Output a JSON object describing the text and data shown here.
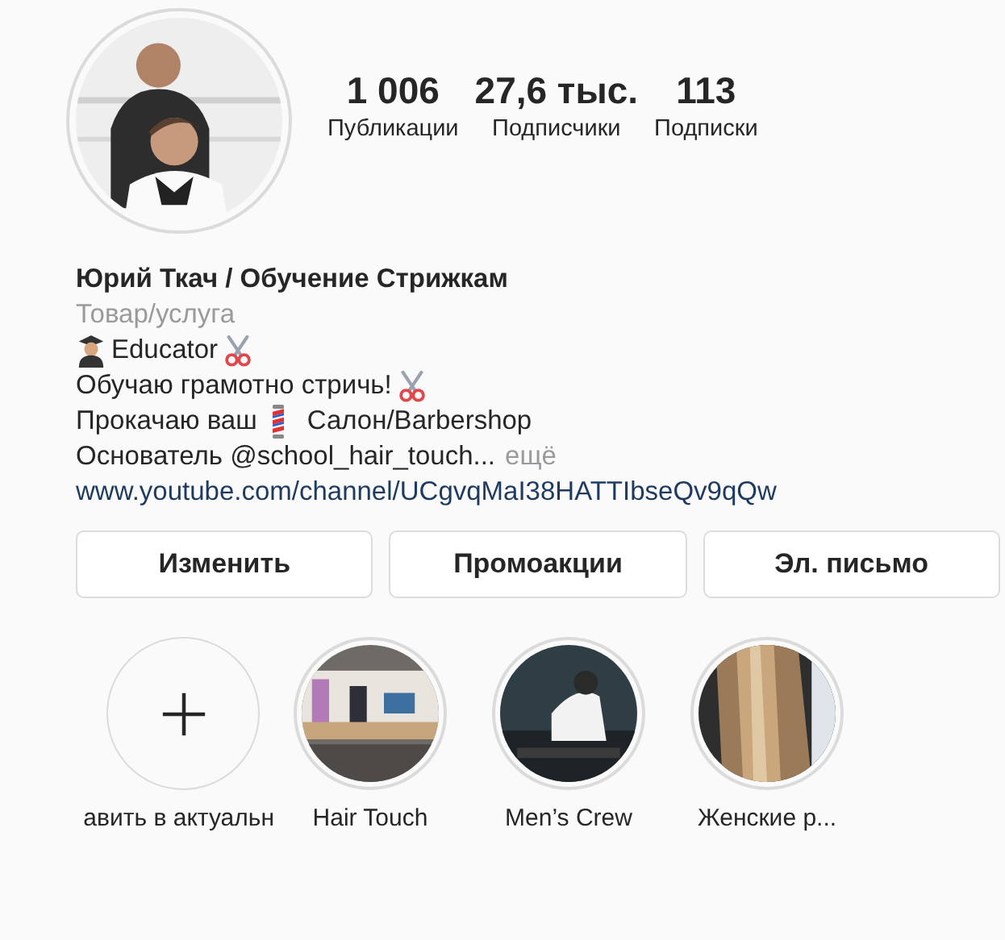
{
  "profile": {
    "avatar": {
      "kind": "picture"
    },
    "stats": [
      {
        "value": "1 006",
        "label": "Публикации"
      },
      {
        "value": "27,6 тыс.",
        "label": "Подписчики"
      },
      {
        "value": "113",
        "label": "Подписки"
      }
    ],
    "name": "Юрий Ткач / Обучение Стрижкам",
    "category": "Товар/услуга",
    "bio": [
      [
        {
          "kind": "graduate"
        },
        {
          "kind": "text",
          "text": "Educator"
        },
        {
          "kind": "scissors"
        }
      ],
      [
        {
          "kind": "text",
          "text": "Обучаю грамотно стричь!"
        },
        {
          "kind": "scissors"
        }
      ],
      [
        {
          "kind": "text",
          "text": "Прокачаю ваш"
        },
        {
          "kind": "pole"
        },
        {
          "kind": "text",
          "text": "Салон/Barbershop"
        }
      ],
      [
        {
          "kind": "text",
          "text": "Основатель @school_hair_touch..."
        },
        {
          "kind": "more",
          "text": "ещё"
        }
      ],
      [
        {
          "kind": "link",
          "text": "www.youtube.com/channel/UCgvqMaI38HATTIbseQv9qQw"
        }
      ]
    ]
  },
  "buttons": [
    "Изменить",
    "Промоакции",
    "Эл. письмо"
  ],
  "highlights": [
    {
      "kind": "add",
      "label": "авить в актуальн"
    },
    {
      "kind": "picture",
      "label": "Hair Touch"
    },
    {
      "kind": "picture",
      "label": "Men’s Crew"
    },
    {
      "kind": "picture",
      "label": "Женские р..."
    }
  ]
}
